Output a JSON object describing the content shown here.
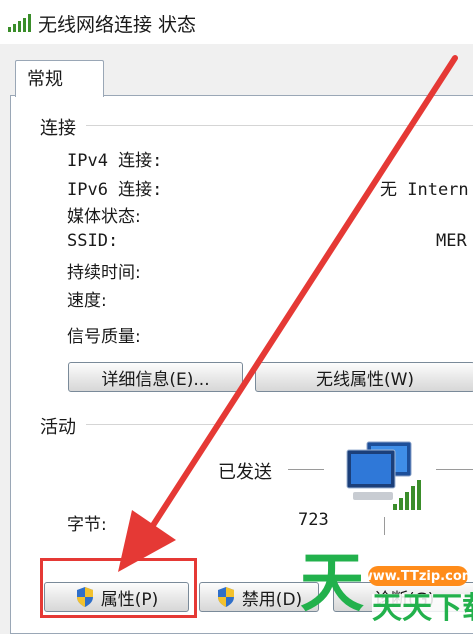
{
  "window": {
    "title": "无线网络连接 状态",
    "icon": "wifi-signal-icon"
  },
  "tabs": [
    {
      "label": "常规"
    }
  ],
  "connection": {
    "group_label": "连接",
    "rows": [
      {
        "label": "IPv4 连接:",
        "value": ""
      },
      {
        "label": "IPv6 连接:",
        "value": "无 Intern"
      },
      {
        "label": "媒体状态:",
        "value": ""
      },
      {
        "label": "SSID:",
        "value": "MER"
      },
      {
        "label": "持续时间:",
        "value": ""
      },
      {
        "label": "速度:",
        "value": ""
      }
    ],
    "signal_label": "信号质量:",
    "details_button": "详细信息(E)...",
    "wireless_props_button": "无线属性(W)"
  },
  "activity": {
    "group_label": "活动",
    "sent_label": "已发送",
    "bytes_label": "字节:",
    "bytes_sent": "723",
    "network_icon": "network-computers-icon"
  },
  "buttons": {
    "properties": "属性(P)",
    "disable": "禁用(D)",
    "diagnose": "诊断(G)"
  },
  "annotation": {
    "color": "#e53935",
    "target": "properties-button"
  },
  "watermark": {
    "url": "www.TTzip.com",
    "text": "天天下载",
    "color": "#22b14c"
  }
}
